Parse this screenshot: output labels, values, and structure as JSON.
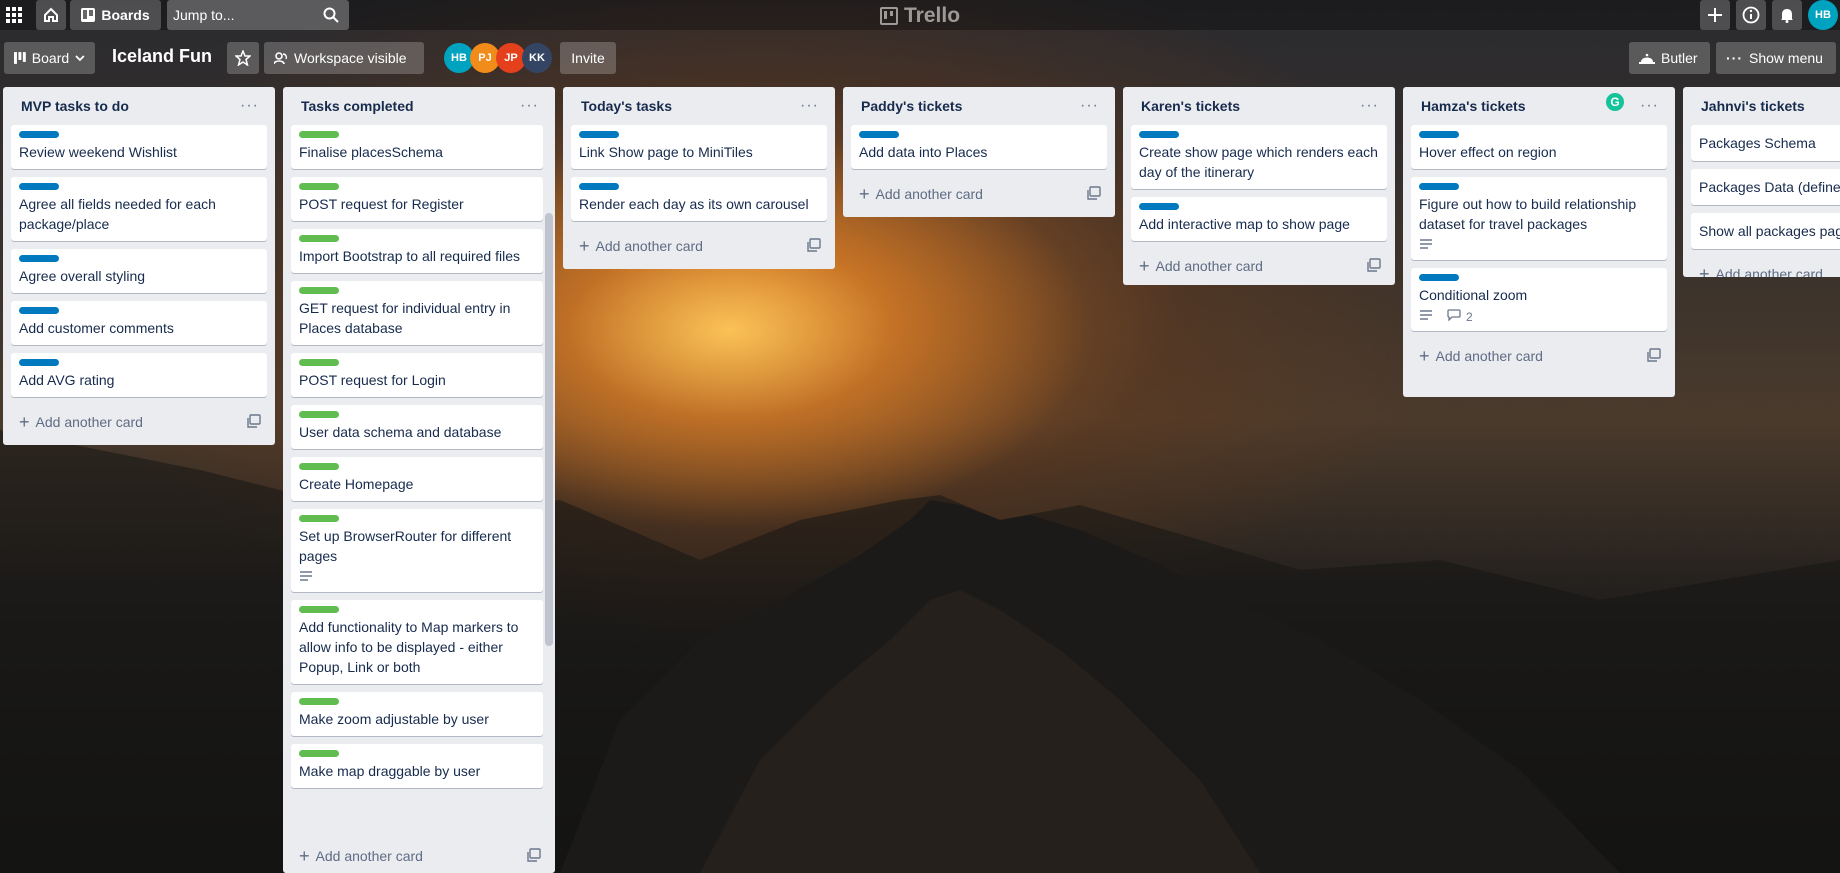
{
  "colors": {
    "label_blue": "#0079bf",
    "label_green": "#61bd4f"
  },
  "topnav": {
    "boards_label": "Boards",
    "jump_placeholder": "Jump to...",
    "brand": "Trello",
    "user_initials": "HB",
    "icons": [
      "apps-grid-icon",
      "home-icon",
      "boards-icon",
      "search-icon",
      "plus-icon",
      "info-icon",
      "bell-icon"
    ]
  },
  "board": {
    "view_label": "Board",
    "title": "Iceland Fun",
    "visibility_label": "Workspace visible",
    "members": [
      {
        "initials": "HB",
        "color": "#00a3bf"
      },
      {
        "initials": "PJ",
        "color": "#f18b1a"
      },
      {
        "initials": "JP",
        "color": "#e5401c"
      },
      {
        "initials": "KK",
        "color": "#344563"
      }
    ],
    "invite_label": "Invite",
    "butler_label": "Butler",
    "show_menu_label": "Show menu"
  },
  "add_card_label": "Add another card",
  "lists": [
    {
      "title": "MVP tasks to do",
      "cards": [
        {
          "label": "blue",
          "text": "Review weekend Wishlist"
        },
        {
          "label": "blue",
          "text": "Agree all fields needed for each package/place"
        },
        {
          "label": "blue",
          "text": "Agree overall styling"
        },
        {
          "label": "blue",
          "text": "Add customer comments"
        },
        {
          "label": "blue",
          "text": "Add AVG rating"
        }
      ]
    },
    {
      "title": "Tasks completed",
      "cards": [
        {
          "label": "green",
          "text": "Finalise placesSchema"
        },
        {
          "label": "green",
          "text": "POST request for Register"
        },
        {
          "label": "green",
          "text": "Import Bootstrap to all required files"
        },
        {
          "label": "green",
          "text": "GET request for individual entry in Places database"
        },
        {
          "label": "green",
          "text": "POST request for Login"
        },
        {
          "label": "green",
          "text": "User data schema and database"
        },
        {
          "label": "green",
          "text": "Create Homepage"
        },
        {
          "label": "green",
          "text": "Set up BrowserRouter for different pages",
          "description": true
        },
        {
          "label": "green",
          "text": "Add functionality to Map markers to allow info to be displayed - either Popup, Link or both"
        },
        {
          "label": "green",
          "text": "Make zoom adjustable by user"
        },
        {
          "label": "green",
          "text": "Make map draggable by user"
        }
      ]
    },
    {
      "title": "Today's tasks",
      "cards": [
        {
          "label": "blue",
          "text": "Link Show page to MiniTiles"
        },
        {
          "label": "blue",
          "text": "Render each day as its own carousel"
        }
      ]
    },
    {
      "title": "Paddy's tickets",
      "cards": [
        {
          "label": "blue",
          "text": "Add data into Places"
        }
      ]
    },
    {
      "title": "Karen's tickets",
      "cards": [
        {
          "label": "blue",
          "text": "Create show page which renders each day of the itinerary"
        },
        {
          "label": "blue",
          "text": "Add interactive map to show page"
        }
      ]
    },
    {
      "title": "Hamza's tickets",
      "cards": [
        {
          "label": "blue",
          "text": "Hover effect on region"
        },
        {
          "label": "blue",
          "text": "Figure out how to build relationship dataset for travel packages",
          "description": true
        },
        {
          "label": "blue",
          "text": "Conditional zoom",
          "description": true,
          "comments": "2"
        }
      ]
    },
    {
      "title": "Jahnvi's tickets",
      "cards": [
        {
          "label": "",
          "text": "Packages Schema"
        },
        {
          "label": "",
          "text": "Packages Data (define"
        },
        {
          "label": "",
          "text": "Show all packages pag"
        }
      ]
    }
  ]
}
